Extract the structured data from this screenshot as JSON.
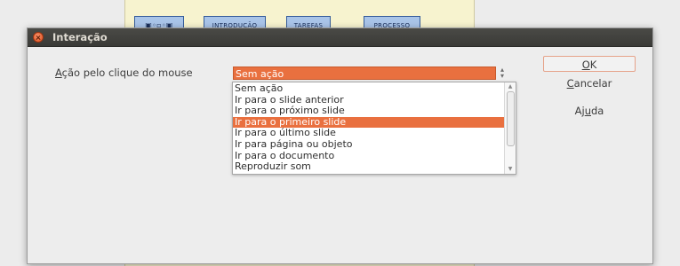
{
  "background_doc": {
    "tabs": [
      "INTRODUÇÃO",
      "TAREFAS",
      "PROCESSO"
    ]
  },
  "dialog": {
    "title": "Interação",
    "action_label": {
      "underlined": "A",
      "rest": "ção pelo clique do mouse"
    },
    "combo_value": "Sem ação",
    "options": [
      "Sem ação",
      "Ir para o slide anterior",
      "Ir para o próximo slide",
      "Ir para o primeiro slide",
      "Ir para o último slide",
      "Ir para página ou objeto",
      "Ir para o documento",
      "Reproduzir som"
    ],
    "selected_index": 3,
    "buttons": {
      "ok": {
        "underlined": "O",
        "rest": "K"
      },
      "cancel": {
        "underlined": "C",
        "rest": "ancelar"
      },
      "help": {
        "before": "Aj",
        "underlined": "u",
        "rest": "da"
      }
    }
  },
  "colors": {
    "accent": "#e9703f",
    "titlebar": "#3f3f3b",
    "dialog_bg": "#ededed"
  },
  "icons": [
    "close-icon",
    "spin-up-icon",
    "spin-down-icon",
    "scroll-up-icon",
    "scroll-down-icon"
  ]
}
